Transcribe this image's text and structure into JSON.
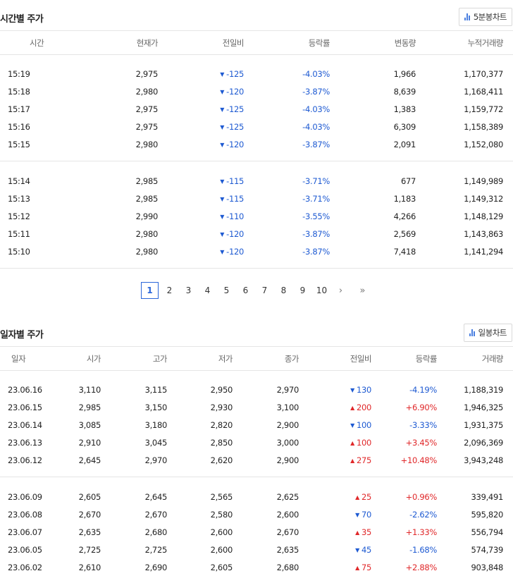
{
  "minute": {
    "title": "시간별 주가",
    "chart_button": "5분봉차트",
    "headers": [
      "시간",
      "현재가",
      "전일비",
      "등락률",
      "변동량",
      "누적거래량"
    ],
    "groups": [
      [
        {
          "time": "15:19",
          "price": "2,975",
          "diff": "-125",
          "dir": "down",
          "rate": "-4.03%",
          "change": "1,966",
          "cum": "1,170,377"
        },
        {
          "time": "15:18",
          "price": "2,980",
          "diff": "-120",
          "dir": "down",
          "rate": "-3.87%",
          "change": "8,639",
          "cum": "1,168,411"
        },
        {
          "time": "15:17",
          "price": "2,975",
          "diff": "-125",
          "dir": "down",
          "rate": "-4.03%",
          "change": "1,383",
          "cum": "1,159,772"
        },
        {
          "time": "15:16",
          "price": "2,975",
          "diff": "-125",
          "dir": "down",
          "rate": "-4.03%",
          "change": "6,309",
          "cum": "1,158,389"
        },
        {
          "time": "15:15",
          "price": "2,980",
          "diff": "-120",
          "dir": "down",
          "rate": "-3.87%",
          "change": "2,091",
          "cum": "1,152,080"
        }
      ],
      [
        {
          "time": "15:14",
          "price": "2,985",
          "diff": "-115",
          "dir": "down",
          "rate": "-3.71%",
          "change": "677",
          "cum": "1,149,989"
        },
        {
          "time": "15:13",
          "price": "2,985",
          "diff": "-115",
          "dir": "down",
          "rate": "-3.71%",
          "change": "1,183",
          "cum": "1,149,312"
        },
        {
          "time": "15:12",
          "price": "2,990",
          "diff": "-110",
          "dir": "down",
          "rate": "-3.55%",
          "change": "4,266",
          "cum": "1,148,129"
        },
        {
          "time": "15:11",
          "price": "2,980",
          "diff": "-120",
          "dir": "down",
          "rate": "-3.87%",
          "change": "2,569",
          "cum": "1,143,863"
        },
        {
          "time": "15:10",
          "price": "2,980",
          "diff": "-120",
          "dir": "down",
          "rate": "-3.87%",
          "change": "7,418",
          "cum": "1,141,294"
        }
      ]
    ]
  },
  "pagination": {
    "pages": [
      "1",
      "2",
      "3",
      "4",
      "5",
      "6",
      "7",
      "8",
      "9",
      "10"
    ],
    "current": "1",
    "next": "›",
    "last": "»"
  },
  "daily": {
    "title": "일자별 주가",
    "chart_button": "일봉차트",
    "headers": [
      "일자",
      "시가",
      "고가",
      "저가",
      "종가",
      "전일비",
      "등락률",
      "거래량"
    ],
    "groups": [
      [
        {
          "date": "23.06.16",
          "open": "3,110",
          "high": "3,115",
          "low": "2,950",
          "close": "2,970",
          "diff": "130",
          "dir": "down",
          "rate": "-4.19%",
          "volume": "1,188,319"
        },
        {
          "date": "23.06.15",
          "open": "2,985",
          "high": "3,150",
          "low": "2,930",
          "close": "3,100",
          "diff": "200",
          "dir": "up",
          "rate": "+6.90%",
          "volume": "1,946,325"
        },
        {
          "date": "23.06.14",
          "open": "3,085",
          "high": "3,180",
          "low": "2,820",
          "close": "2,900",
          "diff": "100",
          "dir": "down",
          "rate": "-3.33%",
          "volume": "1,931,375"
        },
        {
          "date": "23.06.13",
          "open": "2,910",
          "high": "3,045",
          "low": "2,850",
          "close": "3,000",
          "diff": "100",
          "dir": "up",
          "rate": "+3.45%",
          "volume": "2,096,369"
        },
        {
          "date": "23.06.12",
          "open": "2,645",
          "high": "2,970",
          "low": "2,620",
          "close": "2,900",
          "diff": "275",
          "dir": "up",
          "rate": "+10.48%",
          "volume": "3,943,248"
        }
      ],
      [
        {
          "date": "23.06.09",
          "open": "2,605",
          "high": "2,645",
          "low": "2,565",
          "close": "2,625",
          "diff": "25",
          "dir": "up",
          "rate": "+0.96%",
          "volume": "339,491"
        },
        {
          "date": "23.06.08",
          "open": "2,670",
          "high": "2,670",
          "low": "2,580",
          "close": "2,600",
          "diff": "70",
          "dir": "down",
          "rate": "-2.62%",
          "volume": "595,820"
        },
        {
          "date": "23.06.07",
          "open": "2,635",
          "high": "2,680",
          "low": "2,600",
          "close": "2,670",
          "diff": "35",
          "dir": "up",
          "rate": "+1.33%",
          "volume": "556,794"
        },
        {
          "date": "23.06.05",
          "open": "2,725",
          "high": "2,725",
          "low": "2,600",
          "close": "2,635",
          "diff": "45",
          "dir": "down",
          "rate": "-1.68%",
          "volume": "574,739"
        },
        {
          "date": "23.06.02",
          "open": "2,610",
          "high": "2,690",
          "low": "2,605",
          "close": "2,680",
          "diff": "75",
          "dir": "up",
          "rate": "+2.88%",
          "volume": "903,848"
        }
      ]
    ]
  },
  "icons": {
    "chart": "bar-chart-icon",
    "up": "triangle-up-icon",
    "down": "triangle-down-icon"
  },
  "colors": {
    "up": "#e0282a",
    "down": "#1e5ad2",
    "accent": "#2a66d9",
    "chart_icon": "#4a7fe0"
  }
}
